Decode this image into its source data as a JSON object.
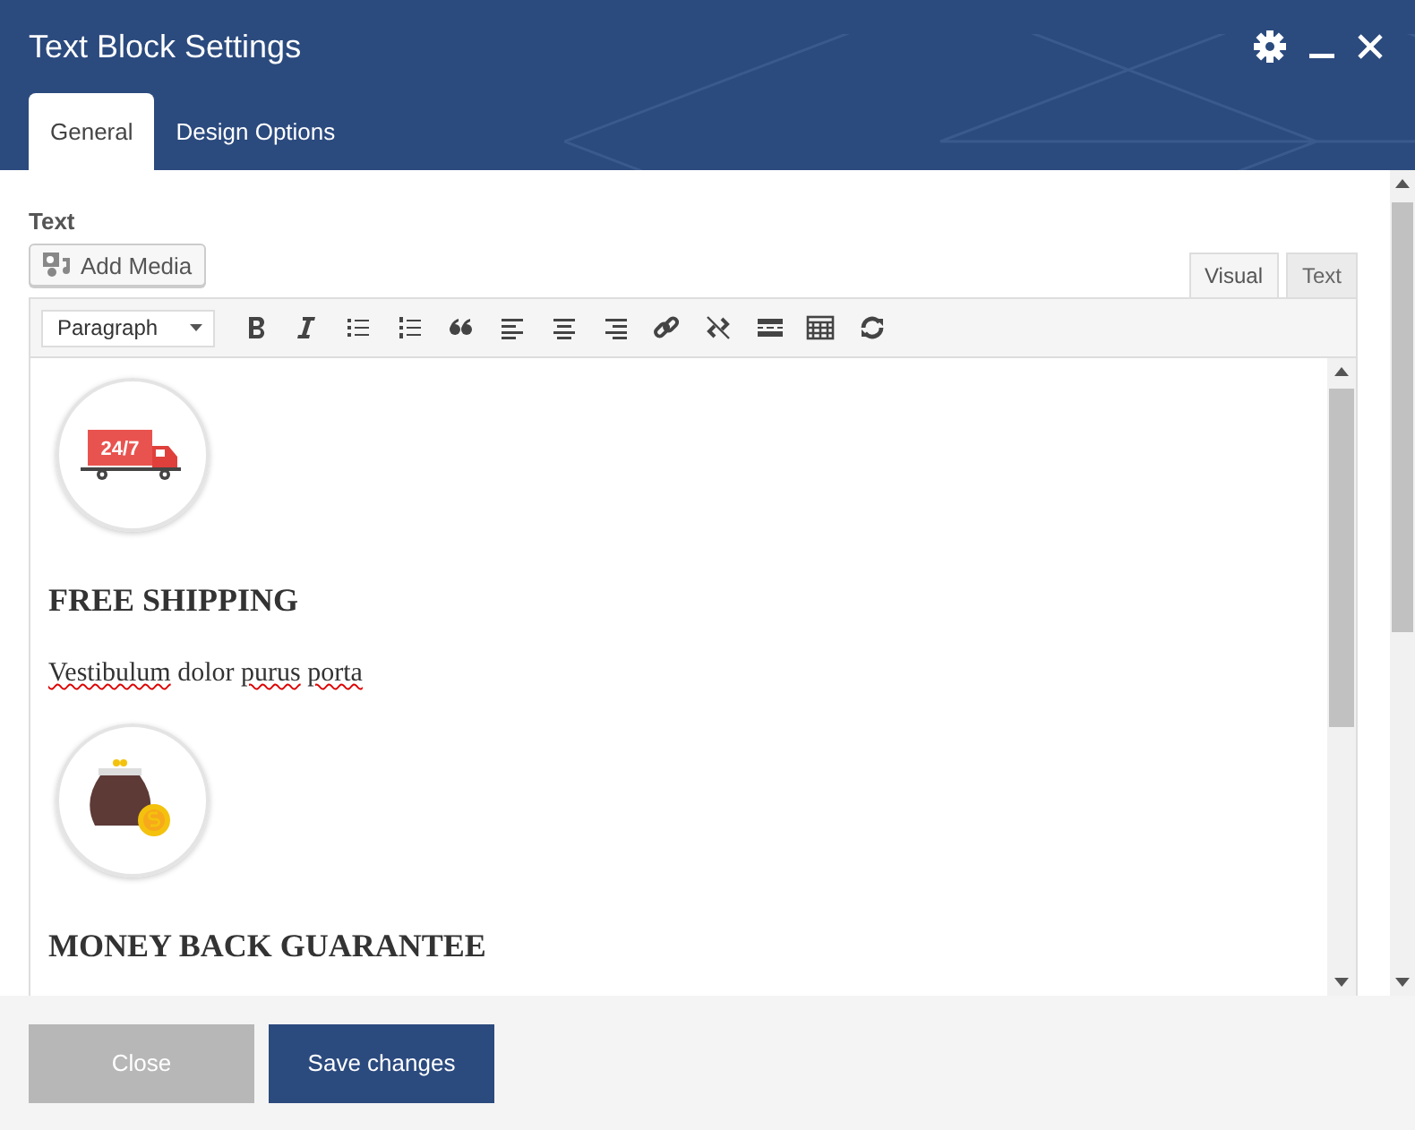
{
  "window": {
    "title": "Text Block Settings"
  },
  "tabs": [
    {
      "label": "General",
      "selected": true
    },
    {
      "label": "Design Options",
      "selected": false
    }
  ],
  "field": {
    "label": "Text",
    "add_media": "Add Media",
    "format": "Paragraph"
  },
  "editor_tabs": [
    {
      "label": "Visual",
      "selected": true
    },
    {
      "label": "Text",
      "selected": false
    }
  ],
  "content": [
    {
      "kind": "truck",
      "badge": "24/7"
    },
    {
      "kind": "heading",
      "text": "FREE SHIPPING"
    },
    {
      "kind": "paragraph",
      "words": [
        {
          "text": "Vestibulum",
          "misspelled": true
        },
        {
          "text": "dolor",
          "misspelled": false
        },
        {
          "text": "purus",
          "misspelled": true
        },
        {
          "text": "porta",
          "misspelled": true
        }
      ]
    },
    {
      "kind": "wallet"
    },
    {
      "kind": "heading",
      "text": "MONEY BACK GUARANTEE"
    }
  ],
  "buttons": [
    {
      "label": "Close",
      "kind": "secondary"
    },
    {
      "label": "Save changes",
      "kind": "primary"
    }
  ]
}
